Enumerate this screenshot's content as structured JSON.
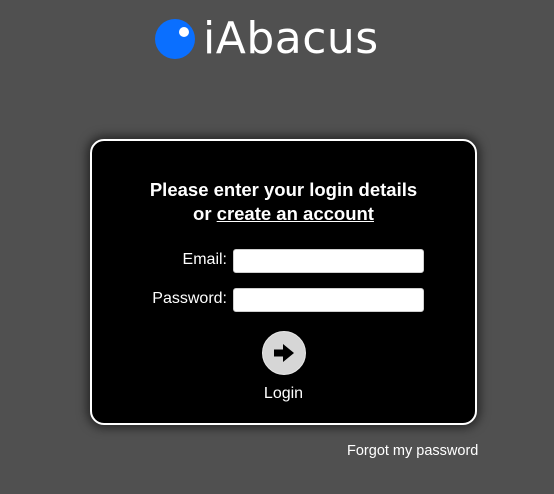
{
  "brand": {
    "name": "iAbacus",
    "accent_color": "#0a6fff",
    "logo_icon": "bead-dot-icon"
  },
  "login_form": {
    "heading_line1": "Please enter your login details",
    "heading_or": "or",
    "create_account_link": "create an account",
    "email_label": "Email:",
    "email_value": "",
    "password_label": "Password:",
    "password_value": "",
    "submit_icon": "arrow-right-icon",
    "submit_label": "Login"
  },
  "forgot_password_link": "Forgot my password"
}
